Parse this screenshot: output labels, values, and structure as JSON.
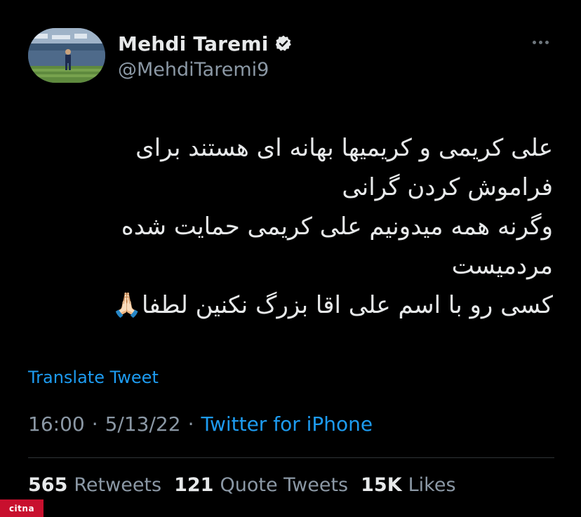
{
  "profile": {
    "display_name": "Mehdi Taremi",
    "handle": "@MehdiTaremi9",
    "verified_icon": "verified-badge-icon",
    "avatar_icon": "profile-photo-football-pitch"
  },
  "tweet": {
    "lines": [
      "علی کریمی و کریمیها بهانه ای هستند  برای",
      "فراموش کردن گرانی",
      "وگرنه همه میدونیم علی کریمی حمایت شده",
      "مردمیست",
      "کسی رو با اسم علی اقا بزرگ نکنین لطفا🙏🏻"
    ]
  },
  "translate_label": "Translate Tweet",
  "meta": {
    "time": "16:00",
    "separator": "·",
    "date": "5/13/22",
    "source": "Twitter for iPhone"
  },
  "stats": {
    "retweets_count": "565",
    "retweets_label": "Retweets",
    "quotes_count": "121",
    "quotes_label": "Quote Tweets",
    "likes_count": "15K",
    "likes_label": "Likes"
  },
  "watermark": "citna",
  "colors": {
    "background": "#000000",
    "primary_text": "#e7e9ea",
    "secondary_text": "#8b98a5",
    "link": "#1d9bf0",
    "divider": "#2f3336"
  }
}
